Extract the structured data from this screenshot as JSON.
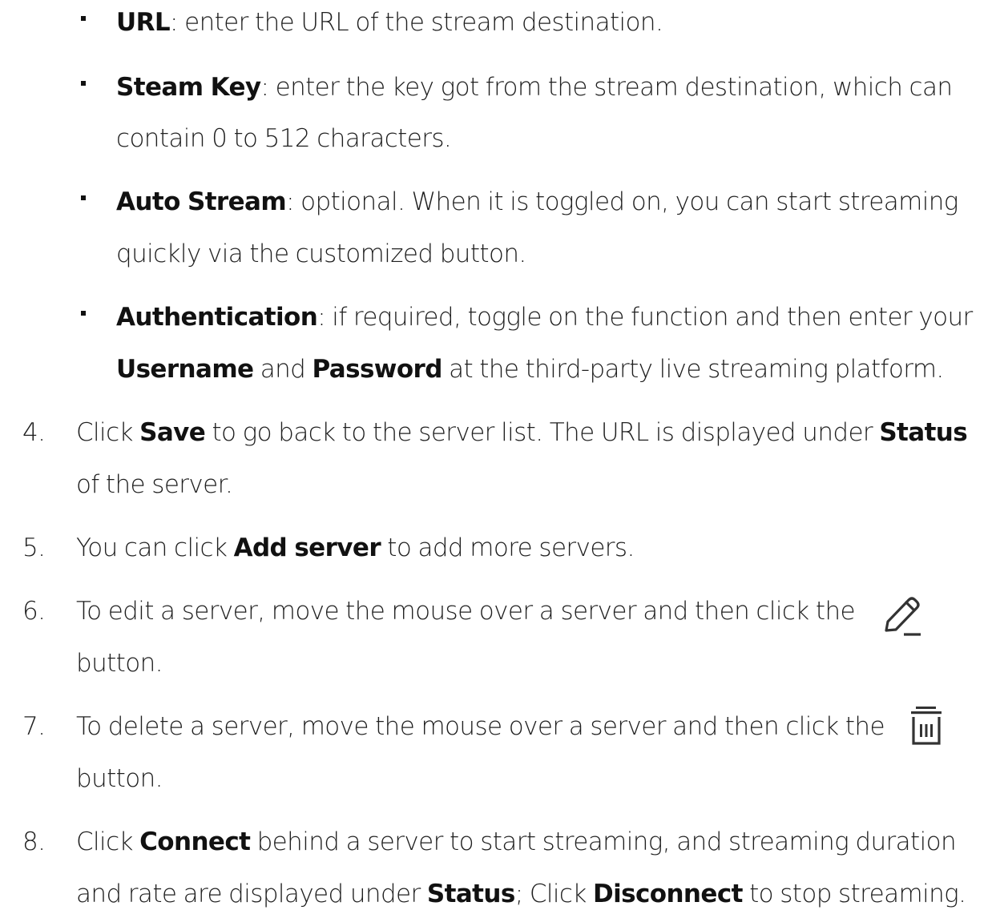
{
  "bullets": [
    {
      "term": "URL",
      "rest": ": enter the URL of the stream destination."
    },
    {
      "term": "Steam Key",
      "rest": ": enter the key got from the stream destination, which can",
      "line2": "contain 0 to 512 characters."
    },
    {
      "term": "Auto Stream",
      "rest": ": optional. When it is toggled on, you can start streaming",
      "line2": "quickly via the customized button."
    },
    {
      "term": "Authentication",
      "rest": ": if required, toggle on the function and then enter your",
      "line2_term1": "Username",
      "line2_mid": " and ",
      "line2_term2": "Password",
      "line2_rest": " at the third-party live streaming platform."
    }
  ],
  "steps": [
    {
      "number": "4.",
      "pre": "Click ",
      "term1": "Save",
      "mid": " to go back to the server list. The URL is displayed under ",
      "term2": "Status",
      "line2": "of the server."
    },
    {
      "number": "5.",
      "pre": "You can click ",
      "term1": "Add server",
      "rest": " to add more servers."
    },
    {
      "number": "6.",
      "text": "To edit a server, move the mouse over a server and then click the",
      "icon": "pencil-icon",
      "line2": "button."
    },
    {
      "number": "7.",
      "text": "To delete a server, move the mouse over a server and then click the",
      "icon": "trash-icon",
      "line2": "button."
    },
    {
      "number": "8.",
      "pre": "Click ",
      "term1": "Connect",
      "mid": " behind a server to start streaming, and streaming duration",
      "line2_pre": "and rate are displayed under ",
      "line2_term1": "Status",
      "line2_mid": "; Click ",
      "line2_term2": "Disconnect",
      "line2_rest": " to stop streaming."
    }
  ]
}
